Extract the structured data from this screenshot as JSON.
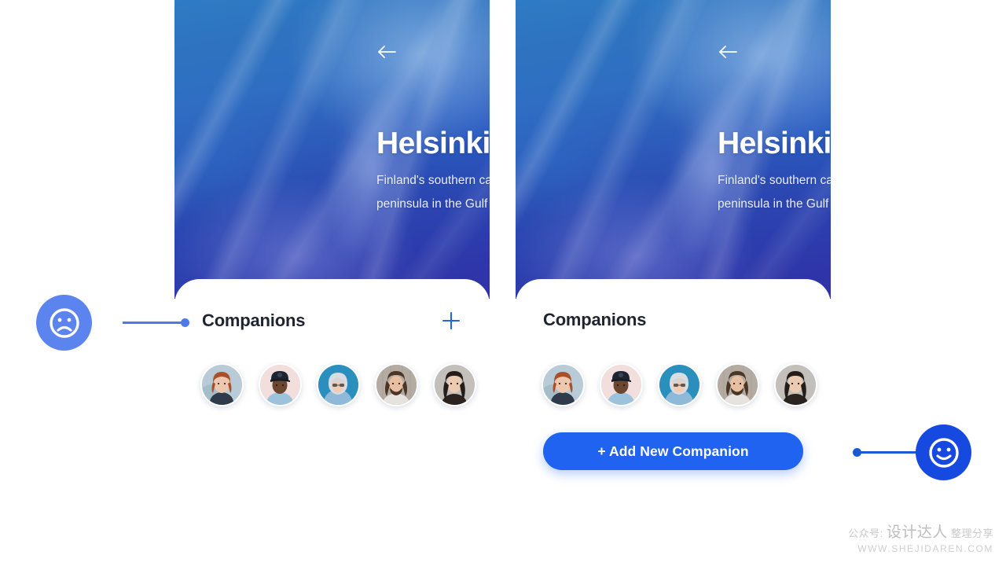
{
  "screens": [
    {
      "id": "before",
      "back_icon": "arrow-left-icon",
      "title": "Helsinki.",
      "subtitle": "Finland's southern capital sits on a peninsula in the Gulf of Finland.",
      "section_title": "Companions",
      "add_icon": "plus-icon",
      "has_plus_icon": true,
      "cta_label": null,
      "has_cta": false
    },
    {
      "id": "after",
      "back_icon": "arrow-left-icon",
      "title": "Helsinki.",
      "subtitle": "Finland's southern capital sits on a peninsula in the Gulf of Finland.",
      "section_title": "Companions",
      "add_icon": null,
      "has_plus_icon": false,
      "cta_label": "+ Add New Companion",
      "has_cta": true
    }
  ],
  "avatars": [
    {
      "name": "avatar-redhead-woman",
      "bg": "#b9cbd6",
      "skin": "#edc7ae",
      "hair": "#a9502a",
      "cloth": "#2f3a4a"
    },
    {
      "name": "avatar-man-with-cap",
      "bg": "#f2dedd",
      "skin": "#6d4630",
      "hair": "#1e2530",
      "cloth": "#9dc2dc"
    },
    {
      "name": "avatar-person-in-hoodie",
      "bg": "#2b8fbe",
      "skin": "#f0cdb2",
      "hair": "#d8dde4",
      "cloth": "#8fb9d8"
    },
    {
      "name": "avatar-bearded-man",
      "bg": "#b4aca2",
      "skin": "#e8c0a1",
      "hair": "#4a3527",
      "cloth": "#e6e3de"
    },
    {
      "name": "avatar-dark-hair-woman",
      "bg": "#c3bfba",
      "skin": "#eccbb2",
      "hair": "#241d1a",
      "cloth": "#2a2320"
    }
  ],
  "annotations": [
    {
      "id": "negative-marker",
      "icon": "sad-face-icon",
      "color": "#5c84ee",
      "side": "left"
    },
    {
      "id": "positive-marker",
      "icon": "happy-face-icon",
      "color": "#1549e0",
      "side": "right"
    }
  ],
  "watermark": {
    "prefix": "公众号:",
    "brand": "设计达人",
    "tag": "整理分享",
    "url": "WWW.SHEJIDAREN.COM"
  },
  "theme": {
    "accent": "#1f63f0",
    "plus_color": "#2563eb",
    "title_color": "#1f2430",
    "hero_top": "#2f7bc4",
    "hero_bottom": "#2f33a4"
  }
}
